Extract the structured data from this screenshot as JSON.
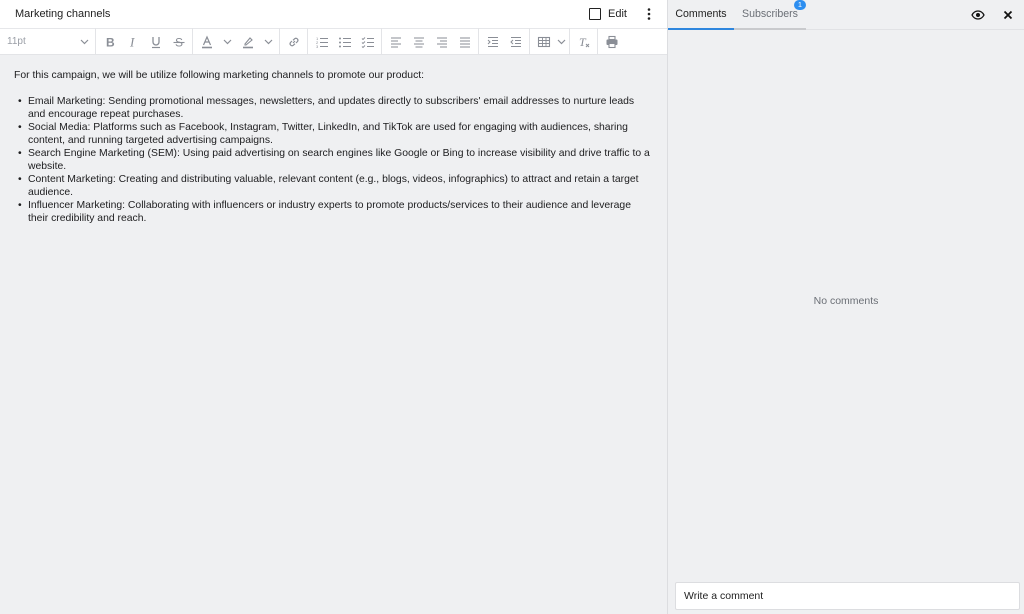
{
  "document": {
    "title": "Marketing channels",
    "edit_label": "Edit",
    "font_size": "11pt",
    "intro": "For this campaign, we will be utilize following marketing channels to promote our product:",
    "bullets": [
      "Email Marketing: Sending promotional messages, newsletters, and updates directly to subscribers' email addresses to nurture leads and encourage repeat purchases.",
      "Social Media: Platforms such as Facebook, Instagram, Twitter, LinkedIn, and TikTok are used for engaging with audiences, sharing content, and running targeted advertising campaigns.",
      "Search Engine Marketing (SEM): Using paid advertising on search engines like Google or Bing to increase visibility and drive traffic to a website.",
      "Content Marketing: Creating and distributing valuable, relevant content (e.g., blogs, videos, infographics) to attract and retain a target audience.",
      "Influencer Marketing: Collaborating with influencers or industry experts to promote products/services to their audience and leverage their credibility and reach."
    ]
  },
  "toolbar": {
    "icons": [
      "bold-icon",
      "italic-icon",
      "underline-icon",
      "strikethrough-icon",
      "text-color-icon",
      "highlight-icon",
      "link-icon",
      "numbered-list-icon",
      "bullet-list-icon",
      "checklist-icon",
      "align-left-icon",
      "align-center-icon",
      "align-right-icon",
      "align-justify-icon",
      "indent-icon",
      "outdent-icon",
      "table-icon",
      "clear-format-icon",
      "print-icon"
    ]
  },
  "panel": {
    "tabs": {
      "comments": "Comments",
      "subscribers": "Subscribers",
      "subscribers_badge": "1"
    },
    "empty_text": "No comments",
    "comment_placeholder": "Write a comment"
  },
  "colors": {
    "accent": "#2e86de",
    "badge": "#2d8ef0",
    "background": "#eff0f2"
  }
}
